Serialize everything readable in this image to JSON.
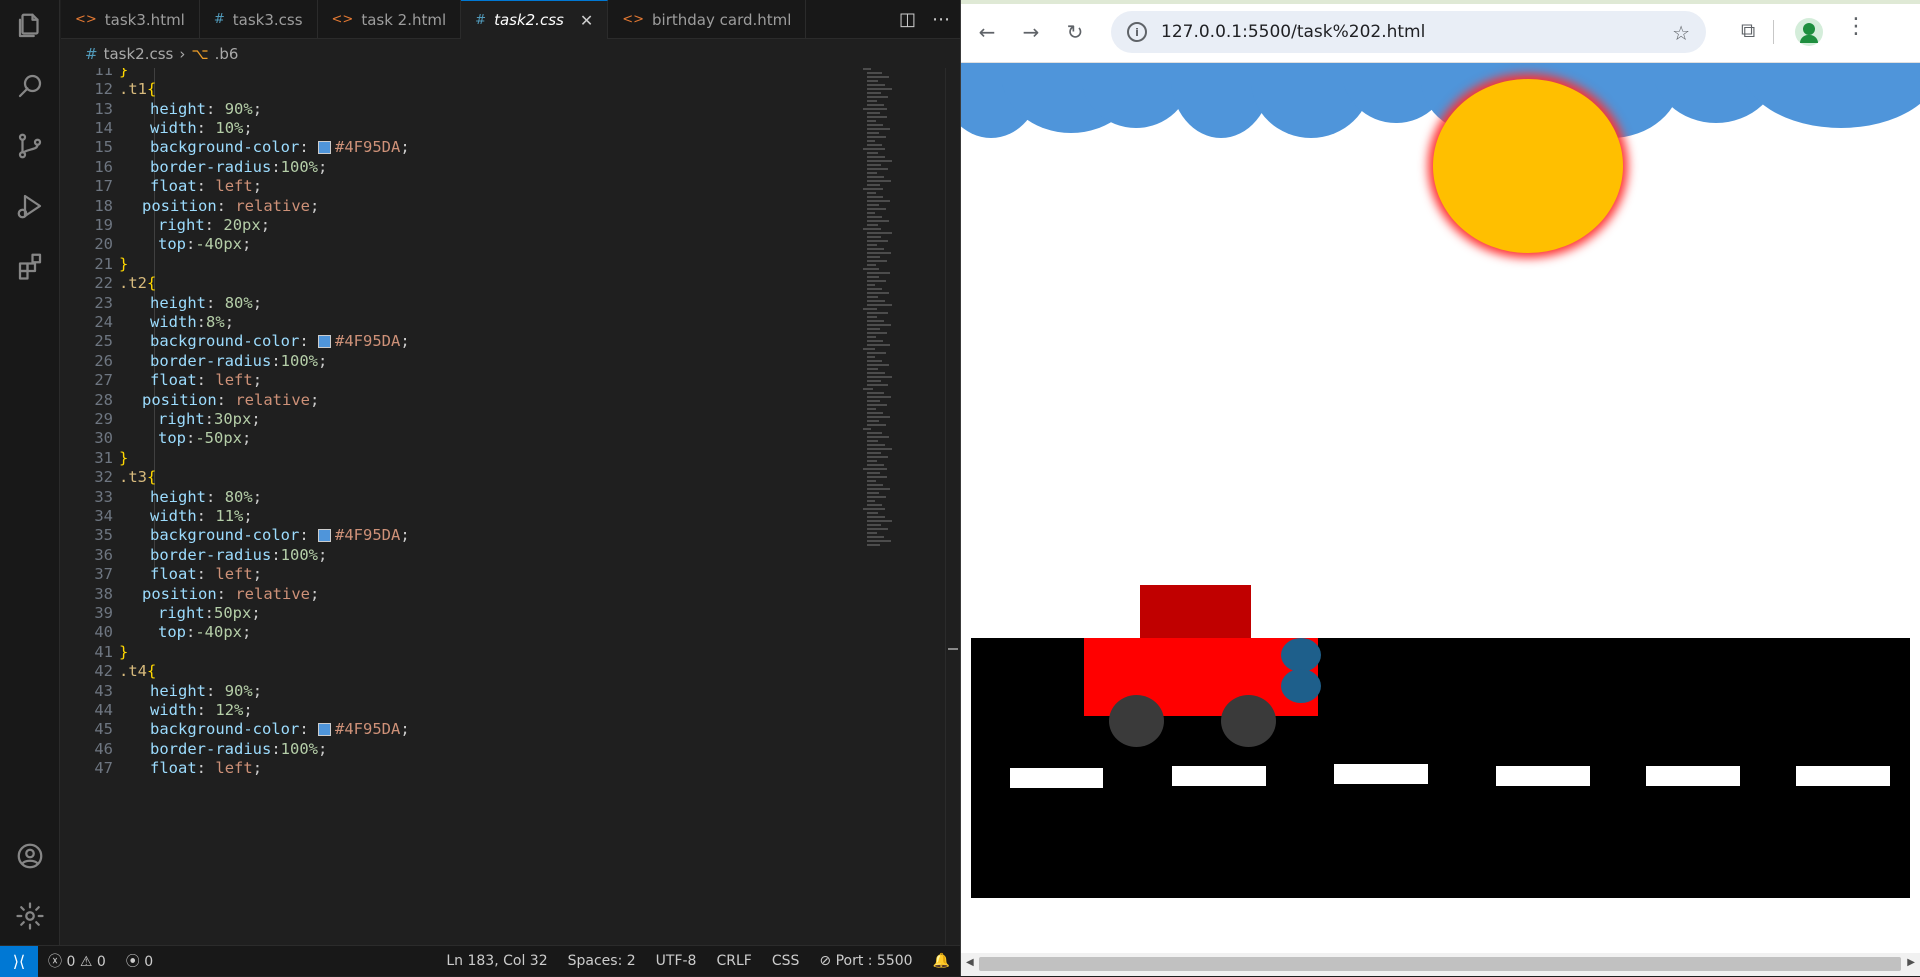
{
  "editor": {
    "tabs": [
      {
        "label": "task3.html",
        "icon": "html-file-icon"
      },
      {
        "label": "task3.css",
        "icon": "css-file-icon"
      },
      {
        "label": "task 2.html",
        "icon": "html-file-icon"
      },
      {
        "label": "task2.css",
        "icon": "css-file-icon",
        "active": true
      },
      {
        "label": "birthday card.html",
        "icon": "html-file-icon"
      }
    ],
    "breadcrumb": {
      "file": "task2.css",
      "symbol": ".b6"
    },
    "code_lines": [
      {
        "n": "11",
        "text": "}"
      },
      {
        "n": "12",
        "text": ".t1{"
      },
      {
        "n": "13",
        "text": "height: 90%;"
      },
      {
        "n": "14",
        "text": "width: 10%;"
      },
      {
        "n": "15",
        "text": "background-color: #4F95DA;"
      },
      {
        "n": "16",
        "text": "border-radius:100%;"
      },
      {
        "n": "17",
        "text": "float: left;"
      },
      {
        "n": "18",
        "text": "position: relative;"
      },
      {
        "n": "19",
        "text": "right: 20px;"
      },
      {
        "n": "20",
        "text": "top:-40px;"
      },
      {
        "n": "21",
        "text": "}"
      },
      {
        "n": "22",
        "text": ".t2{"
      },
      {
        "n": "23",
        "text": "height: 80%;"
      },
      {
        "n": "24",
        "text": "width:8%;"
      },
      {
        "n": "25",
        "text": "background-color: #4F95DA;"
      },
      {
        "n": "26",
        "text": "border-radius:100%;"
      },
      {
        "n": "27",
        "text": "float: left;"
      },
      {
        "n": "28",
        "text": "position: relative;"
      },
      {
        "n": "29",
        "text": "right:30px;"
      },
      {
        "n": "30",
        "text": "top:-50px;"
      },
      {
        "n": "31",
        "text": "}"
      },
      {
        "n": "32",
        "text": ".t3{"
      },
      {
        "n": "33",
        "text": "height: 80%;"
      },
      {
        "n": "34",
        "text": "width: 11%;"
      },
      {
        "n": "35",
        "text": "background-color: #4F95DA;"
      },
      {
        "n": "36",
        "text": "border-radius:100%;"
      },
      {
        "n": "37",
        "text": "float: left;"
      },
      {
        "n": "38",
        "text": "position: relative;"
      },
      {
        "n": "39",
        "text": "right:50px;"
      },
      {
        "n": "40",
        "text": "top:-40px;"
      },
      {
        "n": "41",
        "text": "}"
      },
      {
        "n": "42",
        "text": ".t4{"
      },
      {
        "n": "43",
        "text": "height: 90%;"
      },
      {
        "n": "44",
        "text": "width: 12%;"
      },
      {
        "n": "45",
        "text": "background-color: #4F95DA;"
      },
      {
        "n": "46",
        "text": "border-radius:100%;"
      },
      {
        "n": "47",
        "text": "float: left;"
      }
    ],
    "status": {
      "errors": "0",
      "warnings": "0",
      "ports": "0",
      "cursor": "Ln 183, Col 32",
      "spaces": "Spaces: 2",
      "encoding": "UTF-8",
      "eol": "CRLF",
      "language": "CSS",
      "port": "Port : 5500"
    }
  },
  "browser": {
    "url": "127.0.0.1:5500/task%202.html"
  },
  "colors": {
    "cloud": "#4F95DA",
    "sun": "#FFBF00",
    "road": "#000000",
    "car_body": "#FF0000",
    "car_top": "#C00000",
    "accent": "#0078D4"
  }
}
